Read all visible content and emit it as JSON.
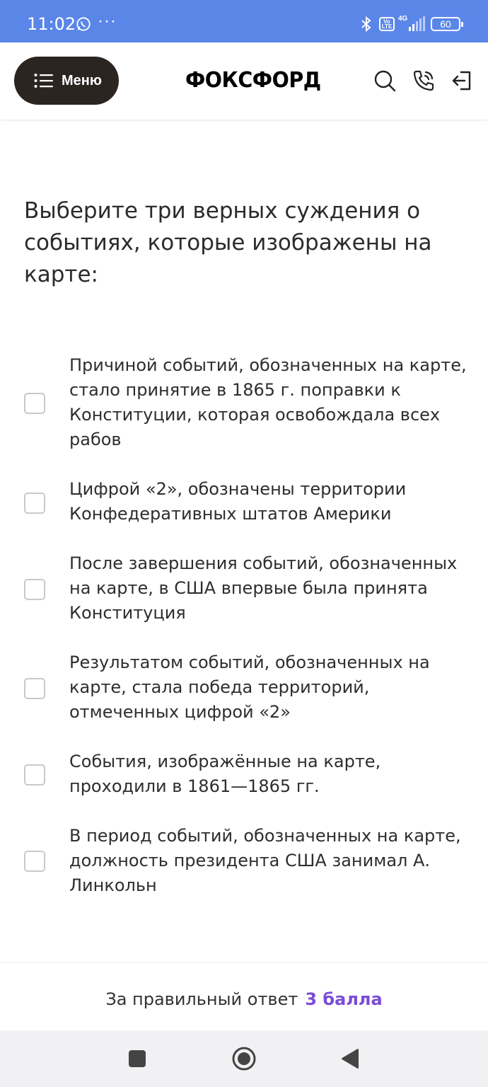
{
  "status_bar": {
    "time": "11:02",
    "more": "···",
    "volte": "Vo LTE",
    "network": "4G",
    "battery": "60",
    "bg_color": "#5a86e8"
  },
  "header": {
    "menu_label": "Меню",
    "logo": "ФОКСФОРД",
    "icons": [
      "search-icon",
      "phone-icon",
      "logout-icon"
    ]
  },
  "question": {
    "text": "Выберите три верных суждения о событиях, которые изображены на карте:"
  },
  "options": [
    {
      "text": "Причиной событий, обозначенных на карте, стало принятие в 1865 г. поправки к Конституции, которая освобождала всех рабов",
      "checked": false
    },
    {
      "text": "Цифрой «2», обозначены территории Конфедеративных штатов Америки",
      "checked": false
    },
    {
      "text": "После завершения событий, обозначенных на карте, в США впервые была принята Конституция",
      "checked": false
    },
    {
      "text": "Результатом событий, обозначенных на карте, стала победа территорий, отмеченных цифрой «2»",
      "checked": false
    },
    {
      "text": "События, изображённые на карте, проходили в 1861—1865 гг.",
      "checked": false
    },
    {
      "text": "В период событий, обозначенных на карте, должность президента США занимал А. Линкольн",
      "checked": false
    }
  ],
  "footer": {
    "label": "За правильный ответ",
    "points": "3 балла",
    "points_color": "#7b4cd6"
  },
  "nav_bar": {
    "buttons": [
      "recent-apps-icon",
      "home-icon",
      "back-icon"
    ]
  }
}
